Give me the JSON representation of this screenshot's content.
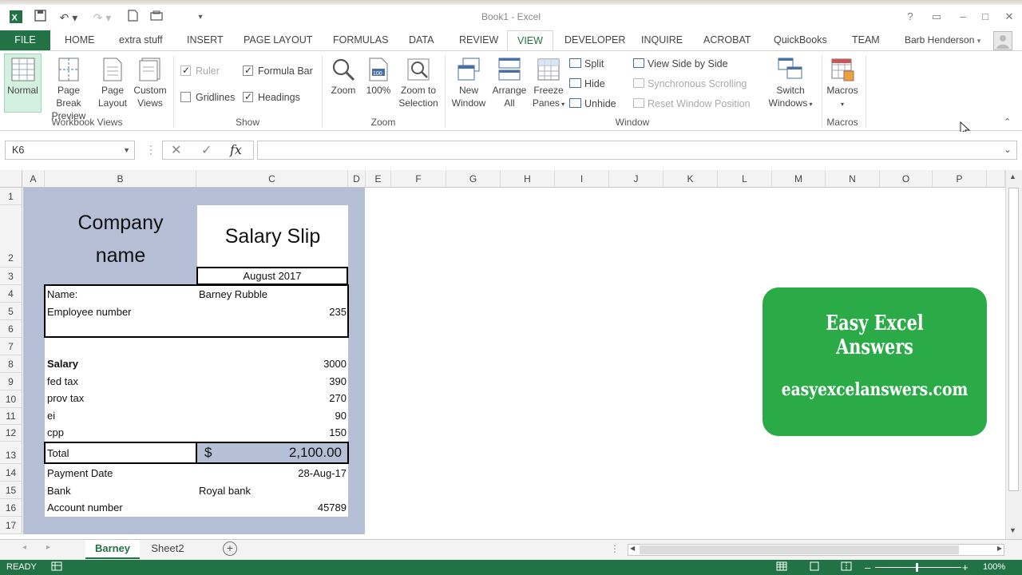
{
  "app": {
    "title": "Book1 - Excel",
    "user": "Barb Henderson"
  },
  "colors": {
    "accent": "#217346",
    "slip_bg": "#b5bfd6",
    "badge": "#2bab48"
  },
  "tabs": [
    "FILE",
    "HOME",
    "extra stuff",
    "INSERT",
    "PAGE LAYOUT",
    "FORMULAS",
    "DATA",
    "REVIEW",
    "VIEW",
    "DEVELOPER",
    "INQUIRE",
    "ACROBAT",
    "QuickBooks",
    "TEAM"
  ],
  "ribbon": {
    "workbook_views": {
      "label": "Workbook Views",
      "normal": "Normal",
      "page_break_1": "Page Break",
      "page_break_2": "Preview",
      "page_layout_1": "Page",
      "page_layout_2": "Layout",
      "custom_views_1": "Custom",
      "custom_views_2": "Views"
    },
    "show": {
      "label": "Show",
      "ruler": "Ruler",
      "gridlines": "Gridlines",
      "formula_bar": "Formula Bar",
      "headings": "Headings"
    },
    "zoom": {
      "label": "Zoom",
      "zoom": "Zoom",
      "hundred": "100%",
      "zoom_sel_1": "Zoom to",
      "zoom_sel_2": "Selection"
    },
    "window": {
      "label": "Window",
      "new_window_1": "New",
      "new_window_2": "Window",
      "arrange_1": "Arrange",
      "arrange_2": "All",
      "freeze_1": "Freeze",
      "freeze_2": "Panes",
      "split": "Split",
      "hide": "Hide",
      "unhide": "Unhide",
      "side_by_side": "View Side by Side",
      "sync_scroll": "Synchronous Scrolling",
      "reset_pos": "Reset Window Position",
      "switch_1": "Switch",
      "switch_2": "Windows"
    },
    "macros": {
      "label": "Macros",
      "macros": "Macros"
    }
  },
  "formula_bar": {
    "name_box": "K6",
    "fx": "fx",
    "value": ""
  },
  "columns": [
    "A",
    "B",
    "C",
    "D",
    "E",
    "F",
    "G",
    "H",
    "I",
    "J",
    "K",
    "L",
    "M",
    "N",
    "O",
    "P"
  ],
  "rows": [
    "1",
    "2",
    "3",
    "4",
    "5",
    "6",
    "7",
    "8",
    "9",
    "10",
    "11",
    "12",
    "13",
    "14",
    "15",
    "16",
    "17"
  ],
  "slip": {
    "company_line1": "Company",
    "company_line2": "name",
    "title": "Salary Slip",
    "period": "August 2017",
    "name_label": "Name:",
    "name_value": "Barney Rubble",
    "emp_label": "Employee number",
    "emp_value": "235",
    "salary_label": "Salary",
    "salary_value": "3000",
    "fedtax_label": "fed tax",
    "fedtax_value": "390",
    "provtax_label": "prov tax",
    "provtax_value": "270",
    "ei_label": "ei",
    "ei_value": "90",
    "cpp_label": "cpp",
    "cpp_value": "150",
    "total_label": "Total",
    "total_currency": "$",
    "total_value": "2,100.00",
    "paydate_label": "Payment Date",
    "paydate_value": "28-Aug-17",
    "bank_label": "Bank",
    "bank_value": "Royal bank",
    "account_label": "Account number",
    "account_value": "45789"
  },
  "badge": {
    "title": "Easy Excel Answers",
    "url": "easyexcelanswers.com"
  },
  "sheets": [
    "Barney",
    "Sheet2"
  ],
  "status": {
    "ready": "READY",
    "zoom": "100%"
  }
}
